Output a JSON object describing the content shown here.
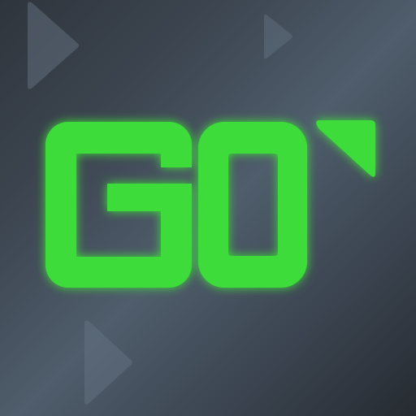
{
  "icon": {
    "wordmark": "GO",
    "colors": {
      "accent": "#3ddc3a",
      "glow": "#33ff33",
      "background_light": "#52606f",
      "background_dark": "#262b31",
      "faint_triangle": "#6a7888"
    },
    "decor_icons": [
      "play-triangle-icon",
      "play-triangle-icon",
      "play-triangle-icon",
      "corner-tick-icon"
    ]
  }
}
